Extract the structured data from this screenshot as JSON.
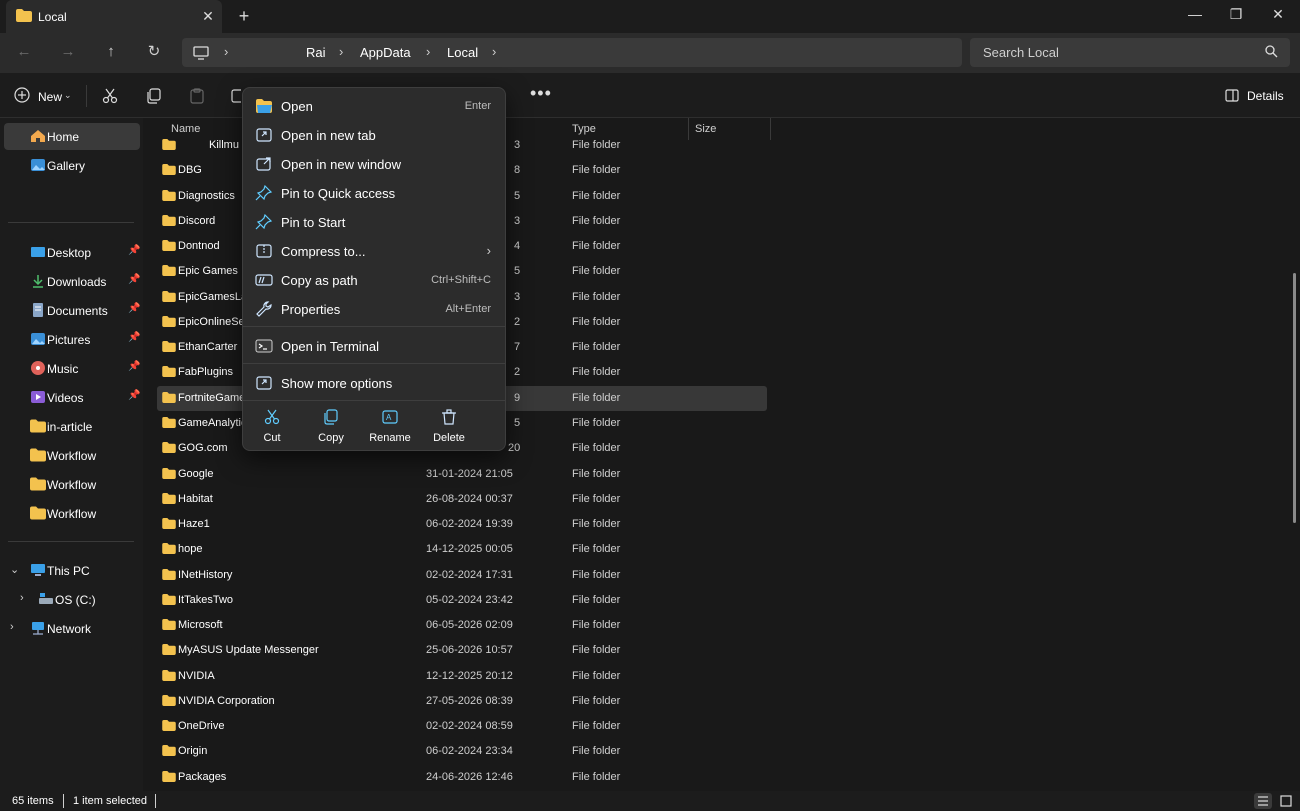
{
  "window": {
    "tab_title": "Local",
    "add_tab": "+",
    "close_tab": "✕",
    "minimize": "—",
    "restore": "❐",
    "close": "✕"
  },
  "address": {
    "breadcrumbs": [
      "Rai",
      "AppData",
      "Local"
    ],
    "search_placeholder": "Search Local"
  },
  "commandbar": {
    "new_label": "New",
    "details_label": "Details"
  },
  "sidebar": {
    "home": "Home",
    "gallery": "Gallery",
    "pinned": [
      "Desktop",
      "Downloads",
      "Documents",
      "Pictures",
      "Music",
      "Videos"
    ],
    "folders": [
      "in-article",
      "Workflow",
      "Workflow",
      "Workflow"
    ],
    "this_pc": "This PC",
    "os_drive": "OS (C:)",
    "network": "Network"
  },
  "columns": {
    "name": "Name",
    "type": "Type",
    "size": "Size"
  },
  "files": [
    {
      "name": "Killmu",
      "date": "3",
      "type": "File folder"
    },
    {
      "name": "DBG",
      "date": "8",
      "type": "File folder"
    },
    {
      "name": "Diagnostics",
      "date": "5",
      "type": "File folder"
    },
    {
      "name": "Discord",
      "date": "3",
      "type": "File folder"
    },
    {
      "name": "Dontnod",
      "date": "4",
      "type": "File folder"
    },
    {
      "name": "Epic Games",
      "date": "5",
      "type": "File folder"
    },
    {
      "name": "EpicGamesLa",
      "date": "3",
      "type": "File folder"
    },
    {
      "name": "EpicOnlineSe",
      "date": "2",
      "type": "File folder"
    },
    {
      "name": "EthanCarter",
      "date": "7",
      "type": "File folder"
    },
    {
      "name": "FabPlugins",
      "date": "2",
      "type": "File folder"
    },
    {
      "name": "FortniteGame",
      "date": "9",
      "type": "File folder"
    },
    {
      "name": "GameAnalytic",
      "date": "5",
      "type": "File folder"
    },
    {
      "name": "GOG.com",
      "date": "20",
      "type": "File folder"
    },
    {
      "name": "Google",
      "date": "31-01-2024 21:05",
      "type": "File folder"
    },
    {
      "name": "Habitat",
      "date": "26-08-2024 00:37",
      "type": "File folder"
    },
    {
      "name": "Haze1",
      "date": "06-02-2024 19:39",
      "type": "File folder"
    },
    {
      "name": "hope",
      "date": "14-12-2025 00:05",
      "type": "File folder"
    },
    {
      "name": "INetHistory",
      "date": "02-02-2024 17:31",
      "type": "File folder"
    },
    {
      "name": "ItTakesTwo",
      "date": "05-02-2024 23:42",
      "type": "File folder"
    },
    {
      "name": "Microsoft",
      "date": "06-05-2026 02:09",
      "type": "File folder"
    },
    {
      "name": "MyASUS Update Messenger",
      "date": "25-06-2026 10:57",
      "type": "File folder"
    },
    {
      "name": "NVIDIA",
      "date": "12-12-2025 20:12",
      "type": "File folder"
    },
    {
      "name": "NVIDIA Corporation",
      "date": "27-05-2026 08:39",
      "type": "File folder"
    },
    {
      "name": "OneDrive",
      "date": "02-02-2024 08:59",
      "type": "File folder"
    },
    {
      "name": "Origin",
      "date": "06-02-2024 23:34",
      "type": "File folder"
    },
    {
      "name": "Packages",
      "date": "24-06-2026 12:46",
      "type": "File folder"
    }
  ],
  "context_menu": {
    "items": [
      {
        "label": "Open",
        "shortcut": "Enter"
      },
      {
        "label": "Open in new tab",
        "shortcut": ""
      },
      {
        "label": "Open in new window",
        "shortcut": ""
      },
      {
        "label": "Pin to Quick access",
        "shortcut": ""
      },
      {
        "label": "Pin to Start",
        "shortcut": ""
      },
      {
        "label": "Compress to...",
        "shortcut": ""
      },
      {
        "label": "Copy as path",
        "shortcut": "Ctrl+Shift+C"
      },
      {
        "label": "Properties",
        "shortcut": "Alt+Enter"
      }
    ],
    "terminal": "Open in Terminal",
    "more_options": "Show more options",
    "actions": [
      "Cut",
      "Copy",
      "Rename",
      "Delete"
    ]
  },
  "status": {
    "item_count": "65 items",
    "selection": "1 item selected"
  },
  "colors": {
    "folder": "#f3c24e",
    "accent": "#60cdff"
  }
}
